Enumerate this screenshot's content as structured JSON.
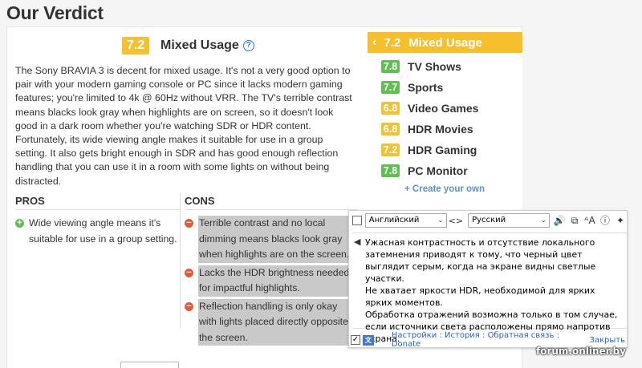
{
  "verdict_title": "Our Verdict",
  "main": {
    "score": "7.2",
    "label": "Mixed Usage",
    "help_icon": "?"
  },
  "description": "The Sony BRAVIA 3 is decent for mixed usage. It's not a very good option to pair with your modern gaming console or PC since it lacks modern gaming features; you're limited to 4k @ 60Hz without VRR. The TV's terrible contrast means blacks look gray when highlights are on screen, so it doesn't look good in a dark room whether you're watching SDR or HDR content. Fortunately, its wide viewing angle makes it suitable for use in a group setting. It also gets bright enough in SDR and has good enough reflection handling that you can use it in a room with some lights on without being distracted.",
  "pros": {
    "heading": "PROS",
    "items": [
      "Wide viewing angle means it's suitable for use in a group setting."
    ]
  },
  "cons": {
    "heading": "CONS",
    "items": [
      "Terrible contrast and no local dimming means blacks look gray when highlights are on the screen.",
      "Lacks the HDR brightness needed for impactful highlights.",
      "Reflection handling is only okay with lights placed directly opposite the screen."
    ]
  },
  "sidebar": {
    "header_chevron": "‹",
    "header_score": "7.2",
    "header_label": "Mixed Usage",
    "items": [
      {
        "score": "7.8",
        "label": "TV Shows",
        "color": "green"
      },
      {
        "score": "7.7",
        "label": "Sports",
        "color": "green"
      },
      {
        "score": "6.8",
        "label": "Video Games",
        "color": "yellow"
      },
      {
        "score": "6.8",
        "label": "HDR Movies",
        "color": "yellow"
      },
      {
        "score": "7.2",
        "label": "HDR Gaming",
        "color": "yellow"
      },
      {
        "score": "7.8",
        "label": "PC Monitor",
        "color": "green"
      }
    ],
    "create_link": "+ Create your own"
  },
  "translator": {
    "source_lang": "Английский",
    "target_lang": "Русский",
    "swap": "<>",
    "translation_lines": [
      "Ужасная контрастность и отсутствие локального затемнения приводят к тому, что черный цвет выглядит серым, когда на экране видны светлые участки.",
      "Не хватает яркости HDR, необходимой для ярких ярких моментов.",
      "Обработка отражений возможна только в том случае, если источники света расположены прямо напротив экрана."
    ],
    "links": [
      "Настройки",
      "История",
      "Обратная связь",
      "Donate"
    ],
    "close": "Закрыть"
  },
  "watermark": "forum.onliner.by",
  "colors": {
    "yellow": "#f2c230",
    "green": "#5fbf50",
    "link": "#2a63b8"
  }
}
